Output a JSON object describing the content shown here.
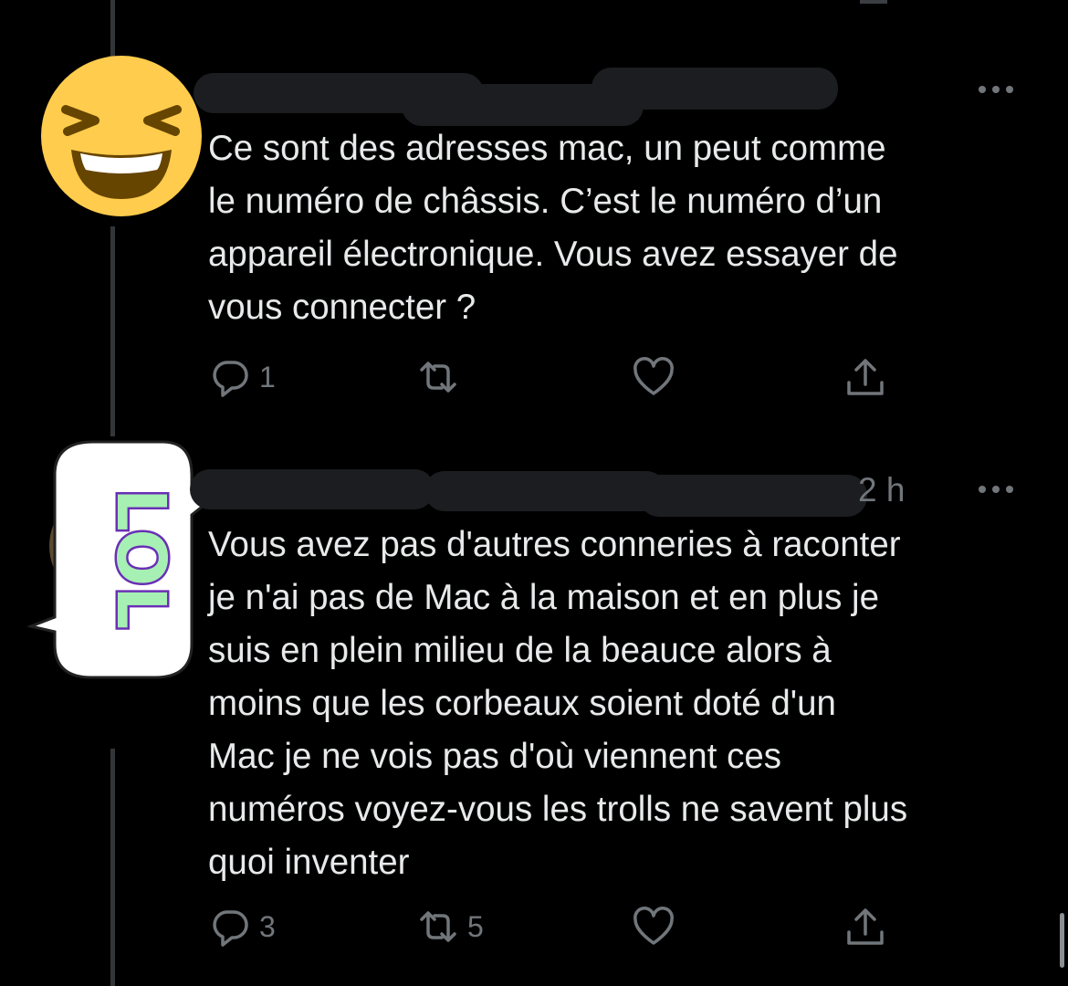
{
  "tweets": [
    {
      "avatar_icon": "laughing-face-emoji",
      "text": "Ce sont des adresses mac, un peut comme\nle numéro de châssis. C’est le numéro d’un\nappareil électronique. Vous avez essayer de\nvous connecter ?",
      "reply_count": "1",
      "retweet_count": "",
      "like_count": ""
    },
    {
      "avatar_icon": "lol-sticker",
      "avatar_text": "LOL",
      "timestamp": "2 h",
      "text": "Vous avez pas d'autres conneries à raconter\nje n'ai pas de Mac à la maison et en plus je\nsuis en plein milieu de la beauce alors à\nmoins que les corbeaux soient doté d'un\nMac je ne vois pas d'où viennent ces\nnuméros voyez-vous les trolls ne savent plus\nquoi inventer",
      "reply_count": "3",
      "retweet_count": "5",
      "like_count": ""
    }
  ],
  "colors": {
    "background": "#000000",
    "text": "#e7e9ea",
    "muted": "#71767b",
    "emoji_yellow": "#ffcc4d",
    "lol_green": "#a6f0b4",
    "lol_purple": "#6a2fb5"
  },
  "icons": [
    "reply-icon",
    "retweet-icon",
    "like-icon",
    "share-icon",
    "more-icon"
  ]
}
